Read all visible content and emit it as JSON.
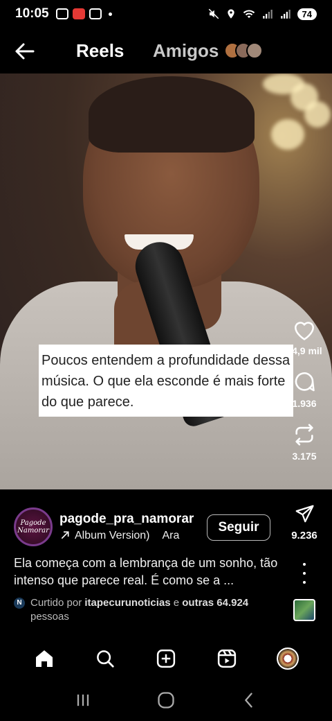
{
  "status_bar": {
    "time": "10:05",
    "battery": "74",
    "icons": [
      "scan-icon",
      "app-icon",
      "screenshot-icon",
      "dot",
      "mute-icon",
      "location-icon",
      "wifi-icon",
      "signal-icon",
      "signal-icon"
    ]
  },
  "top_nav": {
    "reels_label": "Reels",
    "amigos_label": "Amigos"
  },
  "video": {
    "caption": "Poucos entendem a profundidade dessa música. O que ela esconde é mais forte do que parece."
  },
  "actions": {
    "likes": "64,9 mil",
    "comments": "1.936",
    "reposts": "3.175",
    "shares": "9.236"
  },
  "post": {
    "username": "pagode_pra_namorar",
    "avatar_text_line1": "Pagode",
    "avatar_text_line2": "Namorar",
    "audio_text": "Album Version)",
    "audio_artist": "Ara",
    "follow_label": "Seguir",
    "description": "Ela começa com a lembrança de um sonho, tão intenso que parece real. É como se a ...",
    "liked_prefix": "Curtido por ",
    "liked_user": "itapecurunoticias",
    "liked_middle": " e ",
    "liked_others": "outras 64.924",
    "liked_suffix": " pessoas"
  },
  "colors": {
    "background": "#000000",
    "caption_bg": "#ffffff",
    "caption_text": "#222222",
    "follow_border": "#bbbbbb"
  }
}
